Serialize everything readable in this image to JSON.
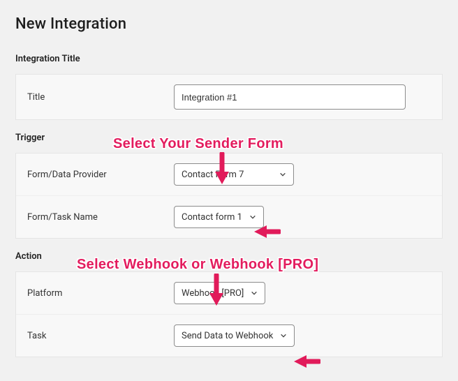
{
  "header": {
    "title": "New Integration"
  },
  "sections": {
    "title": {
      "heading": "Integration Title",
      "row_label": "Title",
      "value": "Integration #1"
    },
    "trigger": {
      "heading": "Trigger",
      "provider_label": "Form/Data Provider",
      "provider_value": "Contact Form 7",
      "task_label": "Form/Task Name",
      "task_value": "Contact form 1"
    },
    "action": {
      "heading": "Action",
      "platform_label": "Platform",
      "platform_value": "Webhook [PRO]",
      "task_label": "Task",
      "task_value": "Send Data to Webhook"
    }
  },
  "annotations": {
    "callout1": "Select Your Sender Form",
    "callout2": "Select Webhook or Webhook [PRO]"
  },
  "colors": {
    "accent": "#e31c5e"
  }
}
